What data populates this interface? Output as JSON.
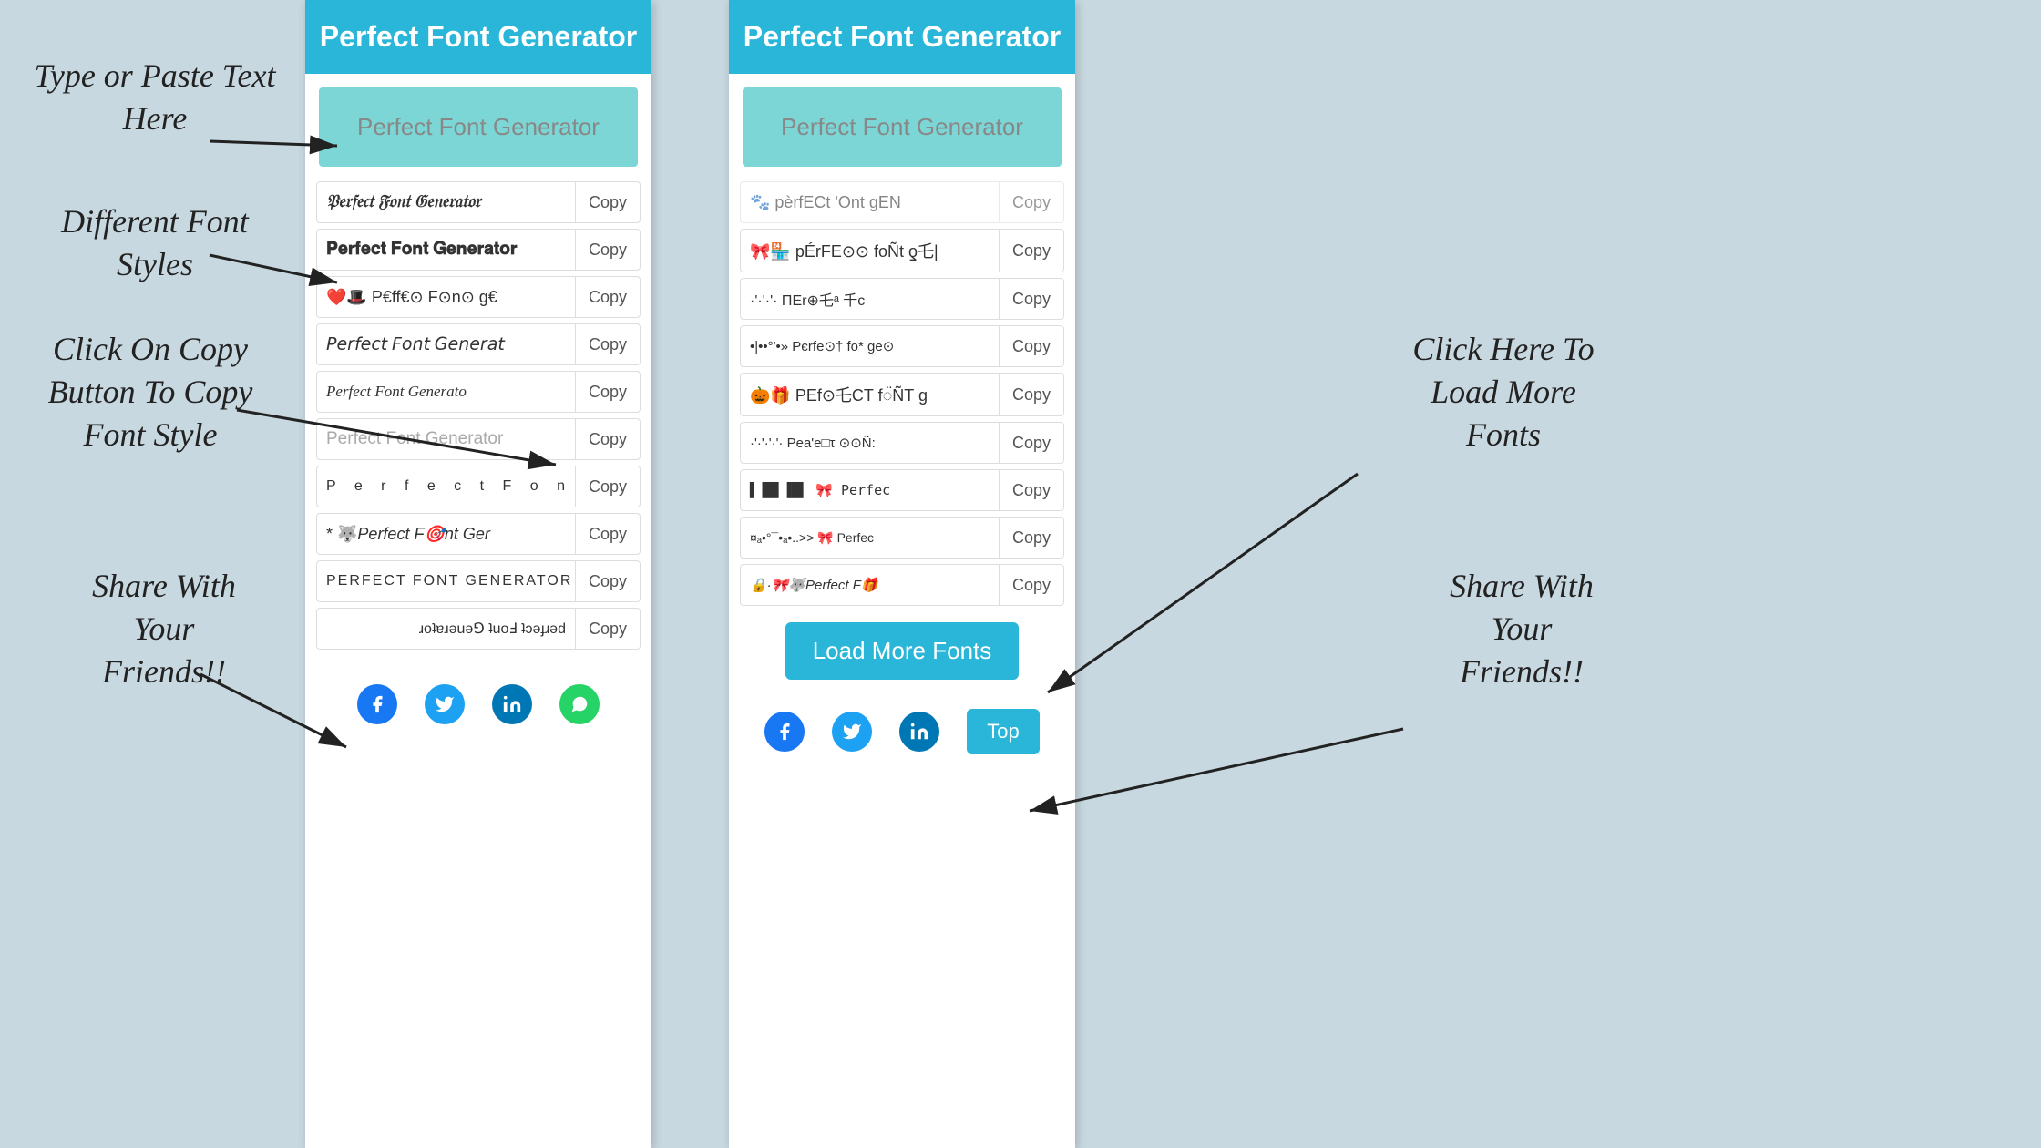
{
  "app": {
    "title": "Perfect Font Generator",
    "background": "#c8d8e0"
  },
  "panels": [
    {
      "id": "left",
      "header": "Perfect Font Generator",
      "input_placeholder": "Perfect Font Generator",
      "fonts": [
        {
          "text": "𝔓erfect Font Generator",
          "style": "blackletter",
          "copy": "Copy"
        },
        {
          "text": "𝐏erfect 𝐅ont 𝐆enerator",
          "style": "bold",
          "copy": "Copy"
        },
        {
          "text": "❤️🎩 P€ff€⊙ F⊙n⊙ g€",
          "style": "emoji",
          "copy": "Copy"
        },
        {
          "text": "𝘗erfect 𝘍ont 𝘎enerat",
          "style": "italic-serif",
          "copy": "Copy"
        },
        {
          "text": "𝙋erfect 𝙁ont 𝙂enerato",
          "style": "italic2",
          "copy": "Copy"
        },
        {
          "text": "Perfect Font Generator",
          "style": "faded",
          "copy": "Copy"
        },
        {
          "text": "P e r f e c t  F o n t",
          "style": "spaced",
          "copy": "Copy"
        },
        {
          "text": "* 🐺 Perfect Font Ger",
          "style": "emoji2",
          "copy": "Copy"
        },
        {
          "text": "PERFECT FONT GENERATOR",
          "style": "upper",
          "copy": "Copy"
        },
        {
          "text": "ɹoʇɐɹǝuǝ⅁ ʇuoℲ ʇɔǝɟɹǝd",
          "style": "flip",
          "copy": "Copy"
        }
      ],
      "social": [
        "facebook",
        "twitter",
        "linkedin",
        "whatsapp"
      ]
    },
    {
      "id": "right",
      "header": "Perfect Font Generator",
      "input_placeholder": "Perfect Font Generator",
      "fonts": [
        {
          "text": "🐾🌹 pÉrfECt 'Ont gEN",
          "style": "emoji",
          "copy": "Copy"
        },
        {
          "text": "$ 🏪 p⊕rFE⊙⊙ foÑt ƍ乇|",
          "style": "emoji2",
          "copy": "Copy"
        },
        {
          "text": "·'·'·'· ΠΕr⊕乇ᵃ 千c",
          "style": "dots",
          "copy": "Copy"
        },
        {
          "text": "•|••°'•» Pєrfe⊙† fo* ge⊙",
          "style": "dots2",
          "copy": "Copy"
        },
        {
          "text": "🎃🎁 PEf⊙乇CT f◌̈ÑT g",
          "style": "emoji3",
          "copy": "Copy"
        },
        {
          "text": "·'·'·'·'· Pea'e□τ ⊙⊙Ñ:",
          "style": "dots3",
          "copy": "Copy"
        },
        {
          "text": "▌▐█▌▐█▌ 🎀 Perfec",
          "style": "barcode",
          "copy": "Copy"
        },
        {
          "text": "¤ₐ•°¯•ₐ•..>>  🎀 Perfec",
          "style": "dots4",
          "copy": "Copy"
        },
        {
          "text": "🔒·🎀🐺 Perfect F🎁",
          "style": "emoji4",
          "copy": "Copy"
        }
      ],
      "load_more": "Load More Fonts",
      "top_btn": "Top",
      "social": [
        "facebook",
        "twitter",
        "linkedin"
      ]
    }
  ],
  "annotations": [
    {
      "id": "type-paste",
      "text": "Type or Paste Text\nHere"
    },
    {
      "id": "diff-fonts",
      "text": "Different Font\nStyles"
    },
    {
      "id": "click-copy",
      "text": "Click On Copy\nButton To Copy\nFont Style"
    },
    {
      "id": "share",
      "text": "Share With\nYour\nFriends!!"
    },
    {
      "id": "load-more-label",
      "text": "Click Here To\nLoad More\nFonts"
    },
    {
      "id": "share-right",
      "text": "Share With\nYour\nFriends!!"
    }
  ]
}
